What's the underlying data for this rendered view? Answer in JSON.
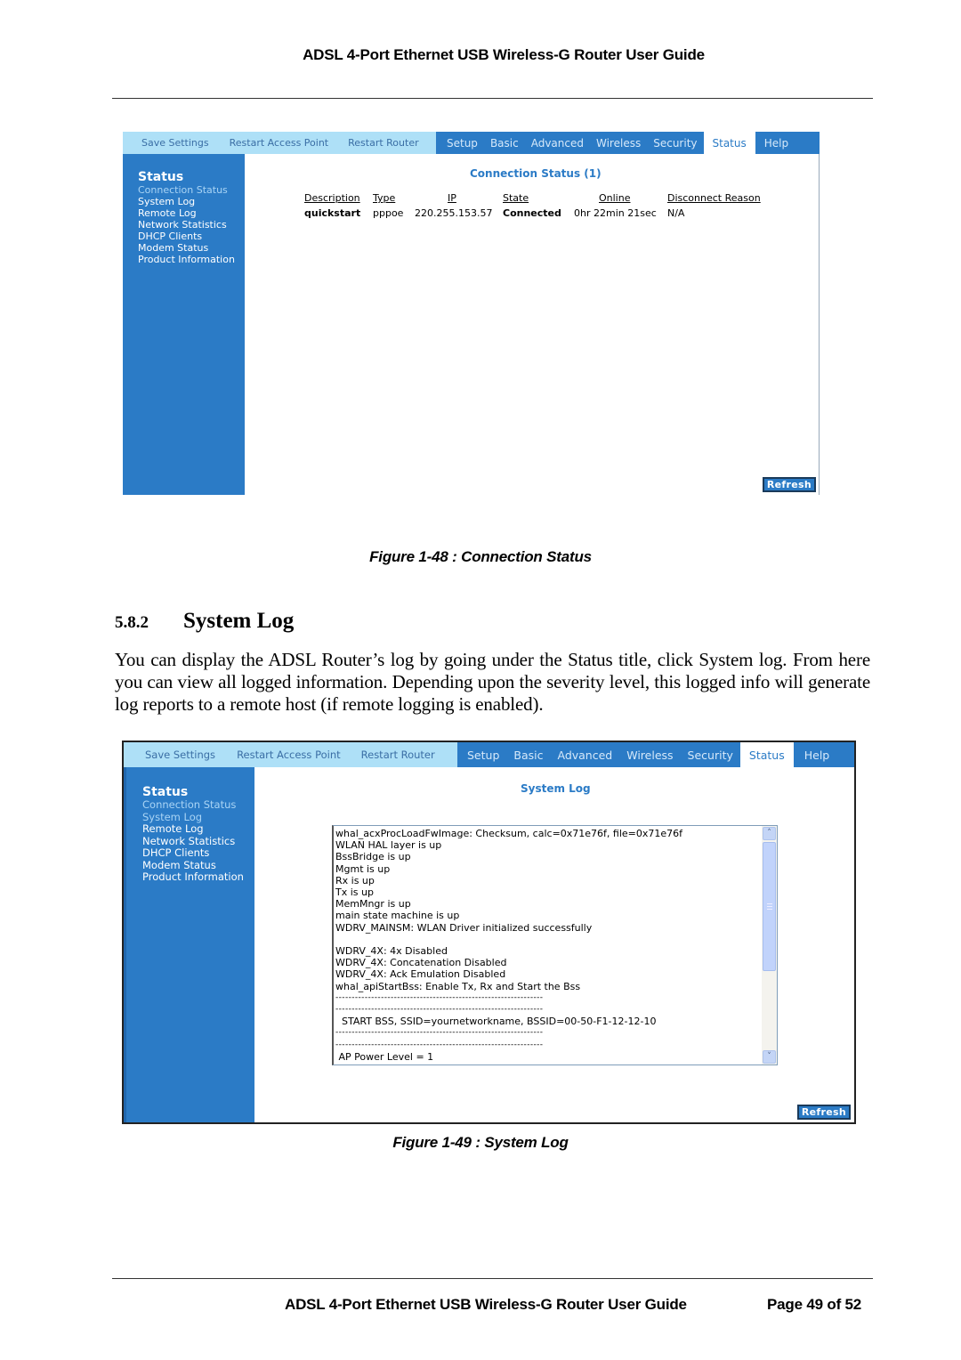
{
  "header": {
    "title": "ADSL 4-Port Ethernet USB Wireless-G Router User Guide"
  },
  "footer": {
    "title": "ADSL 4-Port Ethernet USB Wireless-G Router User Guide",
    "page": "Page 49 of 52"
  },
  "router_ui": {
    "actions": [
      "Save Settings",
      "Restart Access Point",
      "Restart Router"
    ],
    "tabs": [
      "Setup",
      "Basic",
      "Advanced",
      "Wireless",
      "Security",
      "Status",
      "Help"
    ],
    "active_tab": "Status",
    "sidebar": {
      "heading": "Status",
      "items": [
        "Connection Status",
        "System Log",
        "Remote Log",
        "Network Statistics",
        "DHCP Clients",
        "Modem Status",
        "Product Information"
      ]
    },
    "refresh_label": "Refresh",
    "colors": {
      "nav_blue": "#2b7bc6",
      "action_bar": "#aee0f7",
      "title_blue": "#2b7bc6"
    }
  },
  "figure1": {
    "content_title": "Connection Status (1)",
    "table": {
      "headers": [
        "Description",
        "Type",
        "IP",
        "State",
        "Online",
        "Disconnect Reason"
      ],
      "rows": [
        [
          "quickstart",
          "pppoe",
          "220.255.153.57",
          "Connected",
          "0hr 22min 21sec",
          "N/A"
        ]
      ]
    },
    "caption": "Figure 1-48 : Connection Status"
  },
  "section": {
    "number": "5.8.2",
    "title": "System Log",
    "paragraph": "You can display the ADSL Router’s log by going under the Status title, click System log. From here you can view all logged information. Depending upon the severity level, this logged info will generate log reports to a remote host (if remote logging is enabled)."
  },
  "figure2": {
    "content_title": "System Log",
    "log_lines": [
      "whal_acxProcLoadFwImage: Checksum, calc=0x71e76f, file=0x71e76f",
      "WLAN HAL layer is up",
      "BssBridge is up",
      "Mgmt is up",
      "Rx is up",
      "Tx is up",
      "MemMngr is up",
      "main state machine is up",
      "WDRV_MAINSM: WLAN Driver initialized successfully",
      "",
      "WDRV_4X: 4x Disabled",
      "WDRV_4X: Concatenation Disabled",
      "WDRV_4X: Ack Emulation Disabled",
      "whal_apiStartBss: Enable Tx, Rx and Start the Bss",
      "----------------------------------------------------------------",
      "----------------------------------------------------------------",
      "  START BSS, SSID=yournetworkname, BSSID=00-50-F1-12-12-10",
      "----------------------------------------------------------------",
      "----------------------------------------------------------------",
      " AP Power Level = 1"
    ],
    "caption": "Figure 1-49 : System Log"
  }
}
